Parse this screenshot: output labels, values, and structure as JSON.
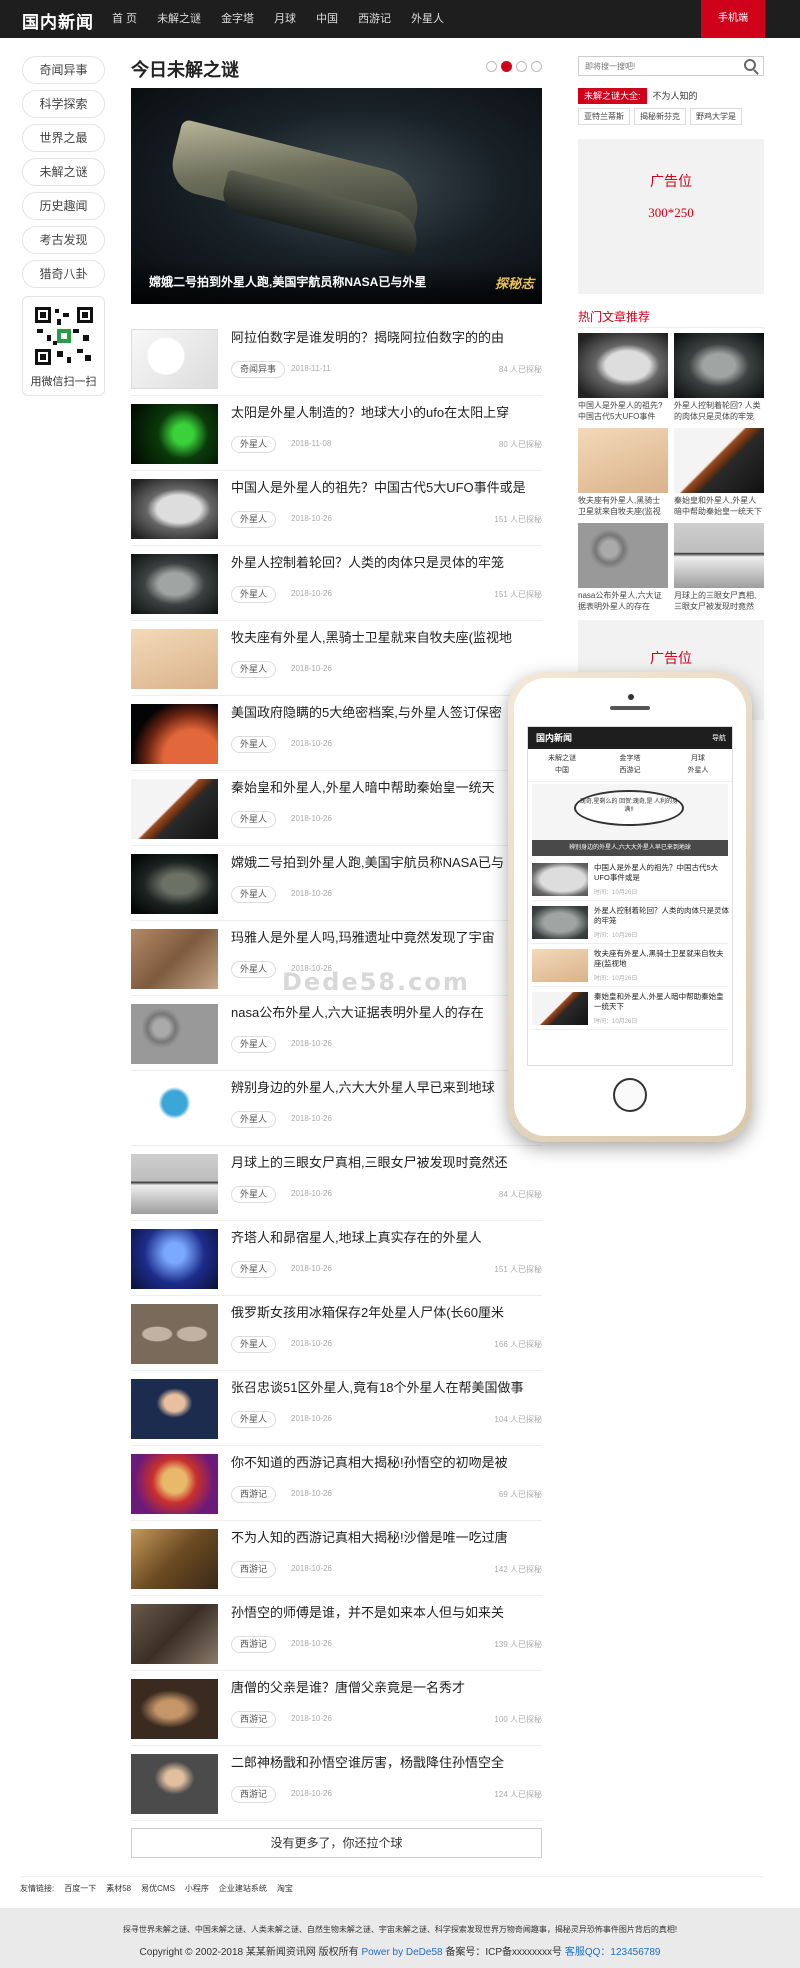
{
  "header": {
    "logo": "国内新闻",
    "nav": [
      "首 页",
      "未解之谜",
      "金字塔",
      "月球",
      "中国",
      "西游记",
      "外星人"
    ],
    "mobile_button": "手机端"
  },
  "sidebar": {
    "categories": [
      "奇闻异事",
      "科学探索",
      "世界之最",
      "未解之谜",
      "历史趣闻",
      "考古发现",
      "猎奇八卦"
    ],
    "qr_label": "用微信扫一扫"
  },
  "main": {
    "title": "今日未解之谜",
    "hero_caption": "嫦娥二号拍到外星人跑,美国宇航员称NASA已与外星",
    "hero_watermark": "探秘志",
    "articles": [
      {
        "title": "阿拉伯数字是谁发明的？揭晓阿拉伯数字的的由",
        "tag": "奇闻异事",
        "date": "2018-11-11",
        "views": "84 人已探秘",
        "thumb": "sketch"
      },
      {
        "title": "太阳是外星人制造的？地球大小的ufo在太阳上穿",
        "tag": "外星人",
        "date": "2018-11-08",
        "views": "80 人已探秘",
        "thumb": "green"
      },
      {
        "title": "中国人是外星人的祖先？中国古代5大UFO事件或是",
        "tag": "外星人",
        "date": "2018-10-26",
        "views": "151 人已探秘",
        "thumb": "moonface"
      },
      {
        "title": "外星人控制着轮回？人类的肉体只是灵体的牢笼",
        "tag": "外星人",
        "date": "2018-10-26",
        "views": "151 人已探秘",
        "thumb": "alien"
      },
      {
        "title": "牧夫座有外星人,黑骑士卫星就来自牧夫座(监视地",
        "tag": "外星人",
        "date": "2018-10-26",
        "views": "",
        "thumb": "sand"
      },
      {
        "title": "美国政府隐瞒的5大绝密档案,与外星人签订保密",
        "tag": "外星人",
        "date": "2018-10-26",
        "views": "14",
        "thumb": "mars"
      },
      {
        "title": "秦始皇和外星人,外星人暗中帮助秦始皇一统天",
        "tag": "外星人",
        "date": "2018-10-26",
        "views": "",
        "thumb": "rod"
      },
      {
        "title": "嫦娥二号拍到外星人跑,美国宇航员称NASA已与",
        "tag": "外星人",
        "date": "2018-10-26",
        "views": "",
        "thumb": "ship"
      },
      {
        "title": "玛雅人是外星人吗,玛雅遗址中竟然发现了宇宙",
        "tag": "外星人",
        "date": "2018-10-26",
        "views": "",
        "thumb": "ruins"
      },
      {
        "title": "nasa公布外星人,六大证据表明外星人的存在",
        "tag": "外星人",
        "date": "2018-10-26",
        "views": "",
        "thumb": "crater"
      },
      {
        "title": "辨别身边的外星人,六大大外星人早已来到地球",
        "tag": "外星人",
        "date": "2018-10-26",
        "views": "12",
        "thumb": "cartoon"
      },
      {
        "title": "月球上的三眼女尸真相,三眼女尸被发现时竟然还",
        "tag": "外星人",
        "date": "2018-10-26",
        "views": "84 人已探秘",
        "thumb": "ufo"
      },
      {
        "title": "齐塔人和昴宿星人,地球上真实存在的外星人",
        "tag": "外星人",
        "date": "2018-10-26",
        "views": "151 人已探秘",
        "thumb": "blue"
      },
      {
        "title": "俄罗斯女孩用冰箱保存2年处星人尸体(长60厘米",
        "tag": "外星人",
        "date": "2018-10-26",
        "views": "166 人已探秘",
        "thumb": "greys"
      },
      {
        "title": "张召忠谈51区外星人,竟有18个外星人在帮美国做事",
        "tag": "外星人",
        "date": "2018-10-26",
        "views": "104 人已探秘",
        "thumb": "man"
      },
      {
        "title": "你不知道的西游记真相大揭秘!孙悟空的初吻是被",
        "tag": "西游记",
        "date": "2018-10-26",
        "views": "69 人已探秘",
        "thumb": "opera"
      },
      {
        "title": "不为人知的西游记真相大揭秘!沙僧是唯一吃过唐",
        "tag": "西游记",
        "date": "2018-10-26",
        "views": "142 人已探秘",
        "thumb": "battle"
      },
      {
        "title": "孙悟空的师傅是谁，并不是如来本人但与如来关",
        "tag": "西游记",
        "date": "2018-10-26",
        "views": "139 人已探秘",
        "thumb": "room"
      },
      {
        "title": "唐僧的父亲是谁？唐僧父亲竟是一名秀才",
        "tag": "西游记",
        "date": "2018-10-26",
        "views": "100 人已探秘",
        "thumb": "child"
      },
      {
        "title": "二郎神杨戬和孙悟空谁厉害，杨戬降住孙悟空全",
        "tag": "西游记",
        "date": "2018-10-26",
        "views": "124 人已探秘",
        "thumb": "warrior"
      }
    ],
    "more_button": "没有更多了，你还拉个球"
  },
  "right": {
    "search_placeholder": "即将搜一搜吧!",
    "tabs": [
      "未解之谜大全:",
      "不为人知的"
    ],
    "links": [
      "亚特兰蒂斯",
      "揭秘新芬克",
      "野鸡大学是"
    ],
    "ad_label": "广告位",
    "ad_size": "300*250",
    "hot_title": "热门文章推荐",
    "hot": [
      {
        "caption": "中国人是外星人的祖先? 中国古代5大UFO事件",
        "thumb": "moonface"
      },
      {
        "caption": "外星人控制着轮回? 人类的肉体只是灵体的牢笼",
        "thumb": "alien"
      },
      {
        "caption": "牧夫座有外星人,黑骑士卫星就来自牧夫座(监视",
        "thumb": "sand"
      },
      {
        "caption": "秦始皇和外星人,外星人暗中帮助秦始皇一统天下",
        "thumb": "rod"
      },
      {
        "caption": "nasa公布外星人,六大证据表明外星人的存在",
        "thumb": "crater"
      },
      {
        "caption": "月球上的三眼女尸真相,三眼女尸被发现时竟然",
        "thumb": "ufo"
      }
    ],
    "ad2_label": "广告位"
  },
  "phone": {
    "logo": "国内新闻",
    "nav_button": "导航",
    "menu": [
      "未解之谜",
      "金字塔",
      "月球",
      "中国",
      "西游记",
      "外星人"
    ],
    "bubble": "瑰奇,星剩么的 回贺:瑰奇,是 人利的身满!!",
    "hero_caption": "辨别身边的外星人,六大大外星人早已来到地球",
    "items": [
      {
        "title": "中国人是外星人的祖先？中国古代5大UFO事件或是",
        "date": "时间：10月26日",
        "thumb": "moonface"
      },
      {
        "title": "外星人控制着轮回？人类的肉体只是灵体的牢笼",
        "date": "时间：10月26日",
        "thumb": "alien"
      },
      {
        "title": "牧夫座有外星人,黑骑士卫星就来自牧夫座(监视地",
        "date": "时间：10月26日",
        "thumb": "sand"
      },
      {
        "title": "秦始皇和外星人,外星人暗中帮助秦始皇一统天下",
        "date": "时间：10月26日",
        "thumb": "rod"
      }
    ]
  },
  "watermark": "Dede58.com",
  "footer": {
    "friend_label": "友情链接:",
    "friend_links": [
      "百度一下",
      "素材58",
      "易优CMS",
      "小程序",
      "企业建站系统",
      "淘宝"
    ],
    "line1": "探寻世界未解之谜、中国未解之谜、人类未解之谜、自然生物未解之谜、宇宙未解之谜、科学探索发现世界万物奇闻趣事，揭秘灵异恐怖事件图片背后的真相!",
    "copyright": "Copyright © 2002-2018 某某新闻资讯网 版权所有 ",
    "powered": "Power by DeDe58",
    "icp": " 备案号：ICP备xxxxxxxx号 ",
    "qq": "客服QQ：123456789"
  }
}
